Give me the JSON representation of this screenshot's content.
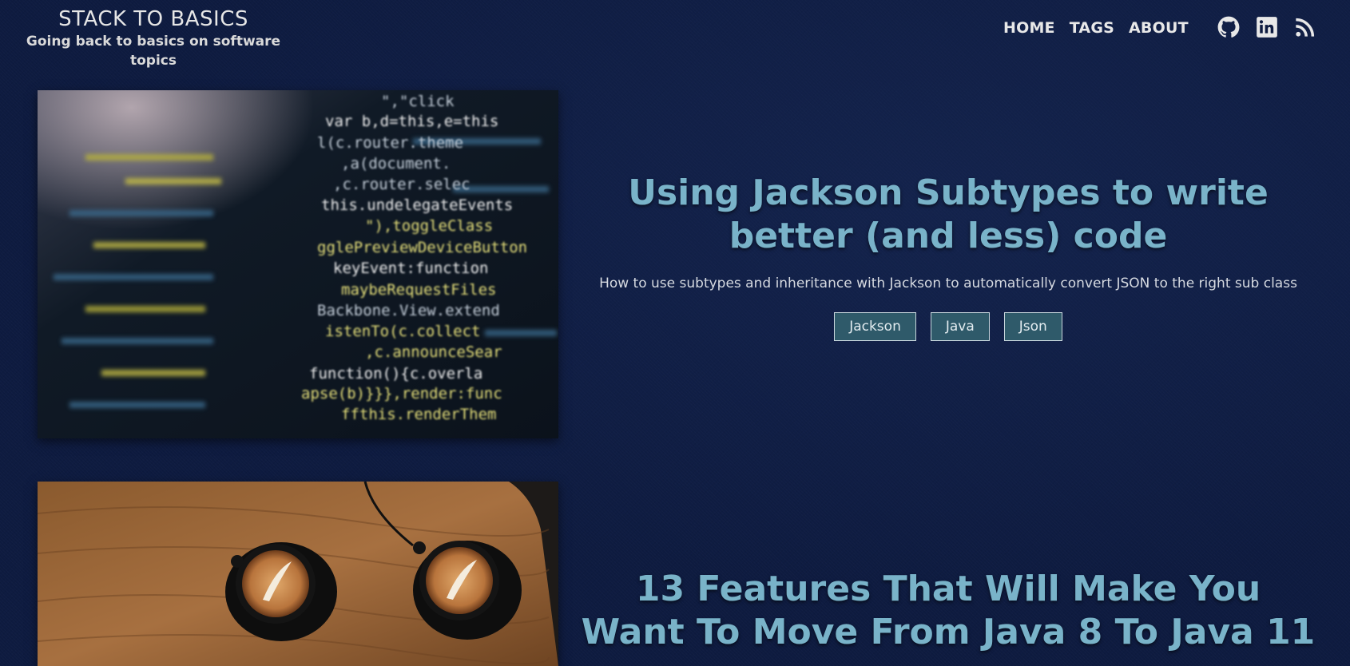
{
  "site": {
    "title": "STACK TO BASICS",
    "subtitle": "Going back to basics on software topics"
  },
  "nav": {
    "items": [
      {
        "label": "HOME"
      },
      {
        "label": "TAGS"
      },
      {
        "label": "ABOUT"
      }
    ]
  },
  "social": {
    "icons": [
      "github-icon",
      "linkedin-icon",
      "rss-icon"
    ]
  },
  "colors": {
    "background": "#0e1b40",
    "title": "#79b3c9",
    "tag_bg": "#2f5a6a"
  },
  "posts": [
    {
      "title": "Using Jackson Subtypes to write better (and less) code",
      "description": "How to use subtypes and inheritance with Jackson to automatically convert JSON to the right sub class",
      "tags": [
        "Jackson",
        "Java",
        "Json"
      ],
      "image": "code-screen-photo"
    },
    {
      "title": "13 Features That Will Make You Want To Move From Java 8 To Java 11",
      "description": "",
      "tags": [],
      "image": "coffee-cups-photo"
    }
  ]
}
